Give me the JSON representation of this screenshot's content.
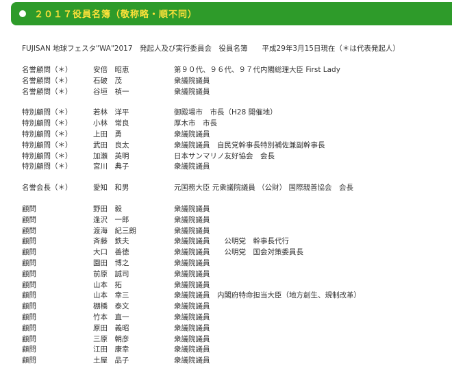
{
  "header": {
    "title": "２０１７役員名簿（敬称略・順不同）"
  },
  "intro": {
    "text": "FUJISAN 地球フェスタ\"WA\"2017　発起人及び実行委員会　役員名簿　　平成29年3月15日現在（＊は代表発起人）"
  },
  "groups": [
    {
      "rows": [
        {
          "role": "名誉顧問（＊）",
          "name": "安倍　昭恵",
          "title": "第９０代、９６代、９７代内閣総理大臣 First Lady"
        },
        {
          "role": "名誉顧問（＊）",
          "name": "石破　茂",
          "title": "衆議院議員"
        },
        {
          "role": "名誉顧問（＊）",
          "name": "谷垣　禎一",
          "title": "衆議院議員"
        }
      ]
    },
    {
      "rows": [
        {
          "role": "特別顧問（＊）",
          "name": "若林　洋平",
          "title": "御殿場市　市長（H28 開催地）"
        },
        {
          "role": "特別顧問（＊）",
          "name": "小林　常良",
          "title": "厚木市　市長"
        },
        {
          "role": "特別顧問（＊）",
          "name": "上田　勇",
          "title": "衆議院議員"
        },
        {
          "role": "特別顧問（＊）",
          "name": "武田　良太",
          "title": "衆議院議員　自民党幹事長特別補佐兼副幹事長"
        },
        {
          "role": "特別顧問（＊）",
          "name": "加瀬　英明",
          "title": "日本サンマリノ友好協会　会長"
        },
        {
          "role": "特別顧問（＊）",
          "name": "宮川　典子",
          "title": "衆議院議員"
        }
      ]
    },
    {
      "rows": [
        {
          "role": "名誉会長（＊）",
          "name": "愛知　和男",
          "title": "元国務大臣 元衆議院議員 （公財） 国際親善協会　会長"
        }
      ]
    },
    {
      "rows": [
        {
          "role": "顧問",
          "name": "野田　毅",
          "title": "衆議院議員"
        },
        {
          "role": "顧問",
          "name": "逢沢　一郎",
          "title": "衆議院議員"
        },
        {
          "role": "顧問",
          "name": "渡海　紀三朗",
          "title": "衆議院議員"
        },
        {
          "role": "顧問",
          "name": "斉藤　鉄夫",
          "title": "衆議院議員　　公明党　幹事長代行"
        },
        {
          "role": "顧問",
          "name": "大口　善徳",
          "title": "衆議院議員　　公明党　国会対策委員長"
        },
        {
          "role": "顧問",
          "name": "園田　博之",
          "title": "衆議院議員"
        },
        {
          "role": "顧問",
          "name": "前原　誠司",
          "title": "衆議院議員"
        },
        {
          "role": "顧問",
          "name": "山本　拓",
          "title": "衆議院議員"
        },
        {
          "role": "顧問",
          "name": "山本　幸三",
          "title": "衆議院議員　内閣府特命担当大臣（地方創生、規制改革）"
        },
        {
          "role": "顧問",
          "name": "棚橋　泰文",
          "title": "衆議院議員"
        },
        {
          "role": "顧問",
          "name": "竹本　直一",
          "title": "衆議院議員"
        },
        {
          "role": "顧問",
          "name": "原田　義昭",
          "title": "衆議院議員"
        },
        {
          "role": "顧問",
          "name": "三原　朝彦",
          "title": "衆議院議員"
        },
        {
          "role": "顧問",
          "name": "江田　康幸",
          "title": "衆議院議員"
        },
        {
          "role": "顧問",
          "name": "土屋　品子",
          "title": "衆議院議員"
        }
      ]
    }
  ]
}
